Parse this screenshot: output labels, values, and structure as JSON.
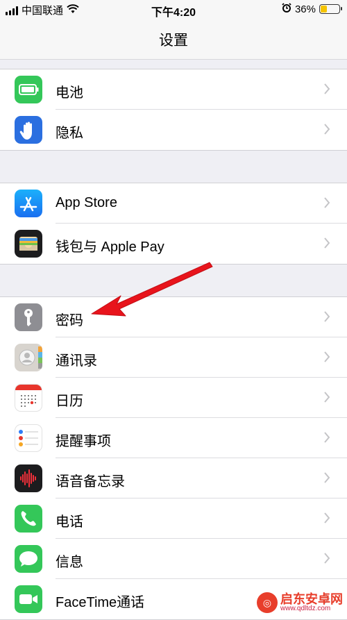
{
  "status_bar": {
    "carrier": "中国联通",
    "time": "下午4:20",
    "battery_percent": "36%",
    "battery_level": 0.36,
    "battery_color": "#f5c400"
  },
  "nav": {
    "title": "设置"
  },
  "sections": [
    {
      "items": [
        {
          "label": "电池",
          "icon": "battery-icon",
          "icon_color": "#34c759"
        },
        {
          "label": "隐私",
          "icon": "hand-privacy-icon",
          "icon_color": "#2b6fe0"
        }
      ]
    },
    {
      "items": [
        {
          "label": "App Store",
          "icon": "app-store-icon",
          "icon_color": "#1a8cfa"
        },
        {
          "label": "钱包与 Apple Pay",
          "icon": "wallet-icon",
          "icon_color": "#1c1c1e"
        }
      ]
    },
    {
      "items": [
        {
          "label": "密码",
          "icon": "key-icon",
          "icon_color": "#8e8e93"
        },
        {
          "label": "通讯录",
          "icon": "contacts-icon",
          "icon_color": "#d8d4ce"
        },
        {
          "label": "日历",
          "icon": "calendar-icon",
          "icon_color": "#ffffff"
        },
        {
          "label": "提醒事项",
          "icon": "reminders-icon",
          "icon_color": "#ffffff"
        },
        {
          "label": "语音备忘录",
          "icon": "voice-memos-icon",
          "icon_color": "#1c1c1e"
        },
        {
          "label": "电话",
          "icon": "phone-icon",
          "icon_color": "#34c759"
        },
        {
          "label": "信息",
          "icon": "messages-icon",
          "icon_color": "#34c759"
        },
        {
          "label": "FaceTime通话",
          "icon": "facetime-icon",
          "icon_color": "#34c759"
        }
      ]
    }
  ],
  "annotation": {
    "arrow_color": "#e8141c",
    "target": "密码"
  },
  "watermark": {
    "name": "启东安卓网",
    "url": "www.qdltdz.com"
  }
}
